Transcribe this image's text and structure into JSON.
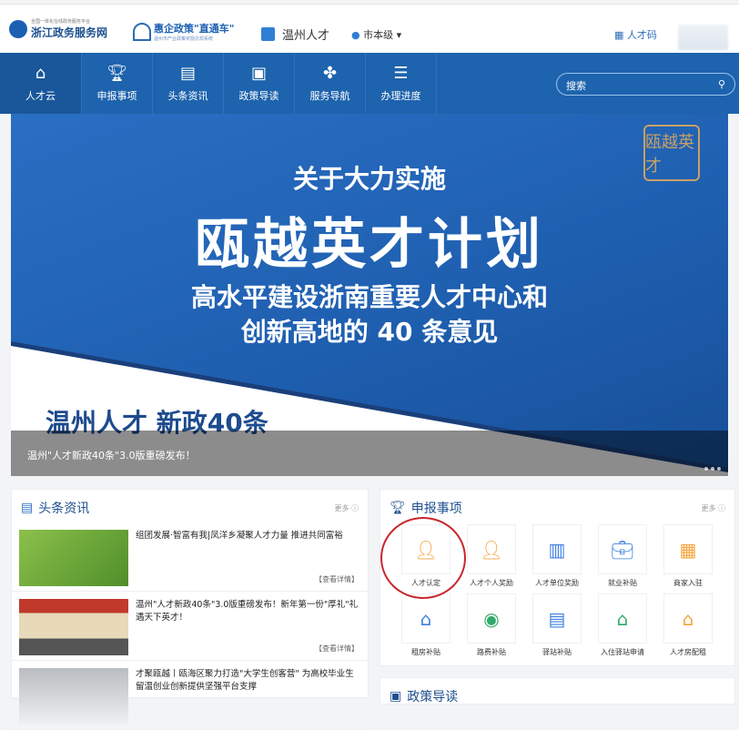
{
  "header": {
    "gov_logo_small": "全国一体化在线政务服务平台",
    "gov_logo": "浙江政务服务网",
    "policy_logo": "惠企政策\"直通车\"",
    "policy_logo_small": "温州市产业政策奖励兑现系统",
    "site": "温州人才",
    "city": "市本级",
    "talent_code": "人才码"
  },
  "nav": {
    "items": [
      {
        "label": "人才云",
        "icon": "home-icon"
      },
      {
        "label": "申报事项",
        "icon": "trophy-icon"
      },
      {
        "label": "头条资讯",
        "icon": "document-icon"
      },
      {
        "label": "政策导读",
        "icon": "book-icon"
      },
      {
        "label": "服务导航",
        "icon": "grid-icon"
      },
      {
        "label": "办理进度",
        "icon": "server-icon"
      }
    ],
    "search_placeholder": "搜索"
  },
  "banner": {
    "line1": "关于大力实施",
    "line2": "瓯越英才计划",
    "line3": "高水平建设浙南重要人才中心和",
    "line4": "创新高地的 40 条意见",
    "brand": "温州人才 新政40条",
    "seal": "瓯越英才",
    "caption": "温州\"人才新政40条\"3.0版重磅发布！"
  },
  "news": {
    "title": "头条资讯",
    "more": "更多",
    "detail": "【查看详情】",
    "items": [
      {
        "title": "组团发展·智富有我|凤洋乡凝聚人才力量 推进共同富裕",
        "color": "#6ea63a"
      },
      {
        "title": "温州\"人才新政40条\"3.0版重磅发布！新年第一份\"厚礼\"礼遇天下英才！",
        "color": "#c0392b"
      },
      {
        "title": "才聚瓯越丨瓯海区聚力打造\"大学生创客营\" 为高校毕业生留温创业创新提供坚强平台支撑",
        "color": "#c9cdd2"
      }
    ]
  },
  "apply": {
    "title": "申报事项",
    "more": "更多",
    "items": [
      {
        "label": "人才认定",
        "color": "#f5a33b"
      },
      {
        "label": "人才个人奖励",
        "color": "#f5a33b"
      },
      {
        "label": "人才单位奖励",
        "color": "#3d7fe0"
      },
      {
        "label": "就业补贴",
        "color": "#3d7fe0"
      },
      {
        "label": "商家入驻",
        "color": "#f5a33b"
      },
      {
        "label": "租房补贴",
        "color": "#3d7fe0"
      },
      {
        "label": "路费补贴",
        "color": "#2faa6a"
      },
      {
        "label": "驿站补贴",
        "color": "#3d7fe0"
      },
      {
        "label": "入住驿站申请",
        "color": "#2faa6a"
      },
      {
        "label": "人才房配租",
        "color": "#f5a33b"
      }
    ]
  },
  "policy": {
    "title": "政策导读"
  }
}
